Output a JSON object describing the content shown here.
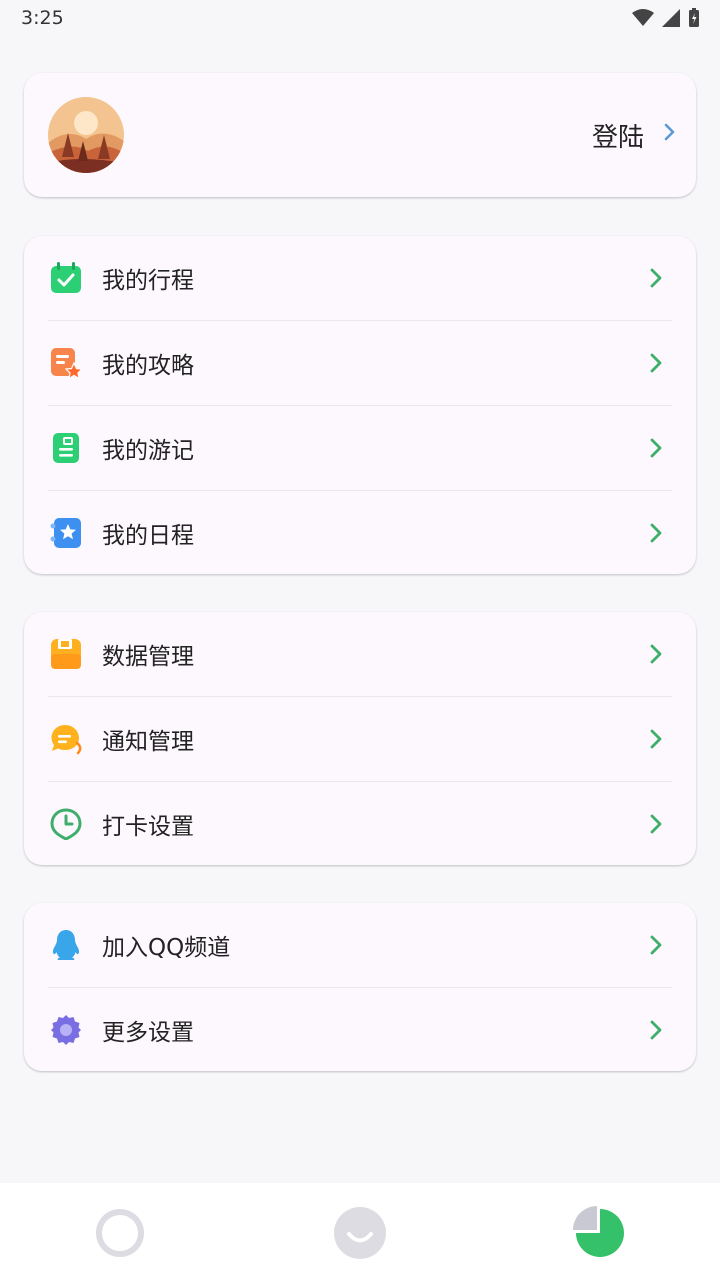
{
  "status_bar": {
    "time": "3:25"
  },
  "profile": {
    "login_label": "登陆",
    "avatar_icon": "landscape-avatar"
  },
  "group1": [
    {
      "label": "我的行程",
      "icon": "calendar-check-icon"
    },
    {
      "label": "我的攻略",
      "icon": "guide-star-icon"
    },
    {
      "label": "我的游记",
      "icon": "travel-note-icon"
    },
    {
      "label": "我的日程",
      "icon": "schedule-star-icon"
    }
  ],
  "group2": [
    {
      "label": "数据管理",
      "icon": "floppy-icon"
    },
    {
      "label": "通知管理",
      "icon": "chat-bubble-icon"
    },
    {
      "label": "打卡设置",
      "icon": "clock-icon"
    }
  ],
  "group3": [
    {
      "label": "加入QQ频道",
      "icon": "qq-penguin-icon"
    },
    {
      "label": "更多设置",
      "icon": "gear-icon"
    }
  ],
  "bottom_nav": {
    "tabs": [
      "ring-icon",
      "smile-icon",
      "pie-chart-icon"
    ],
    "active_index": 2
  },
  "colors": {
    "arrow": "#3fae6b",
    "login_chevron": "#5b9ad6",
    "active_tab": "#35c06a",
    "inactive_tab": "#dcdce2"
  }
}
